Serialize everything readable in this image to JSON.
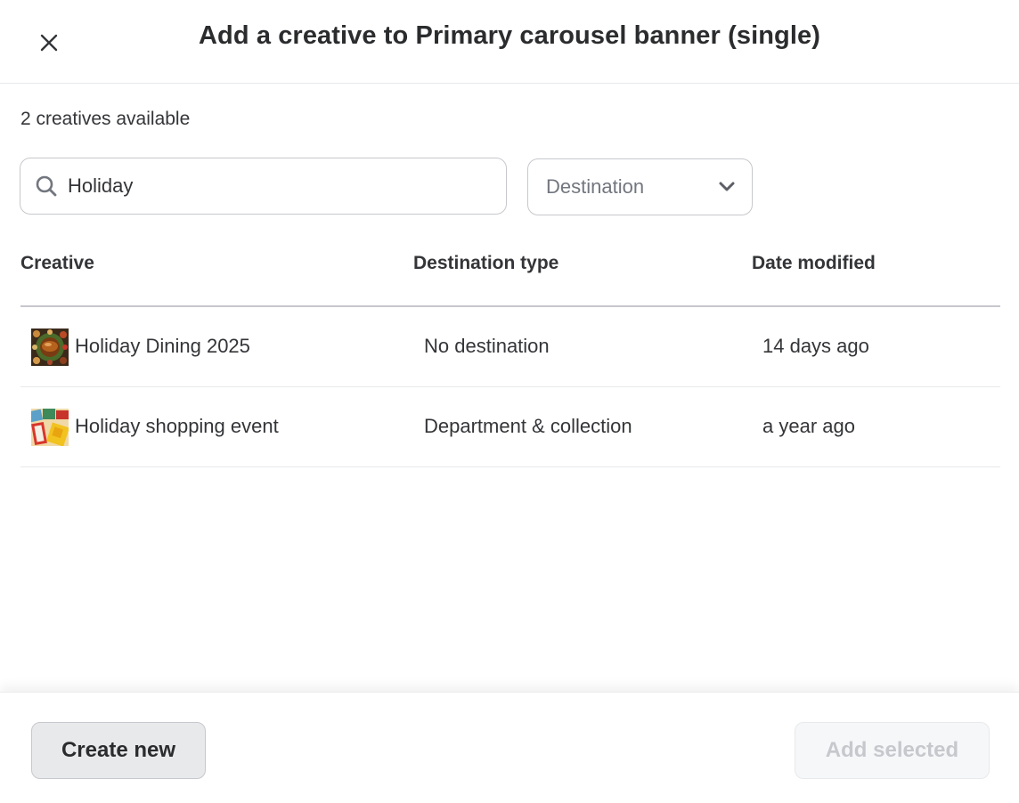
{
  "header": {
    "title": "Add a creative to Primary carousel banner (single)",
    "close_icon": "close-icon"
  },
  "summary": {
    "count_text": "2 creatives available"
  },
  "search": {
    "value": "Holiday",
    "icon": "search-icon"
  },
  "filters": {
    "destination": {
      "label": "Destination",
      "icon": "chevron-down-icon"
    }
  },
  "table": {
    "columns": [
      "Creative",
      "Destination type",
      "Date modified"
    ],
    "rows": [
      {
        "name": "Holiday Dining 2025",
        "destination_type": "No destination",
        "date_modified": "14 days ago",
        "thumbnail": "holiday-dining-thumbnail"
      },
      {
        "name": "Holiday shopping event",
        "destination_type": "Department & collection",
        "date_modified": "a year ago",
        "thumbnail": "holiday-shopping-thumbnail"
      }
    ]
  },
  "footer": {
    "create_label": "Create new",
    "add_label": "Add selected",
    "add_disabled": true
  }
}
